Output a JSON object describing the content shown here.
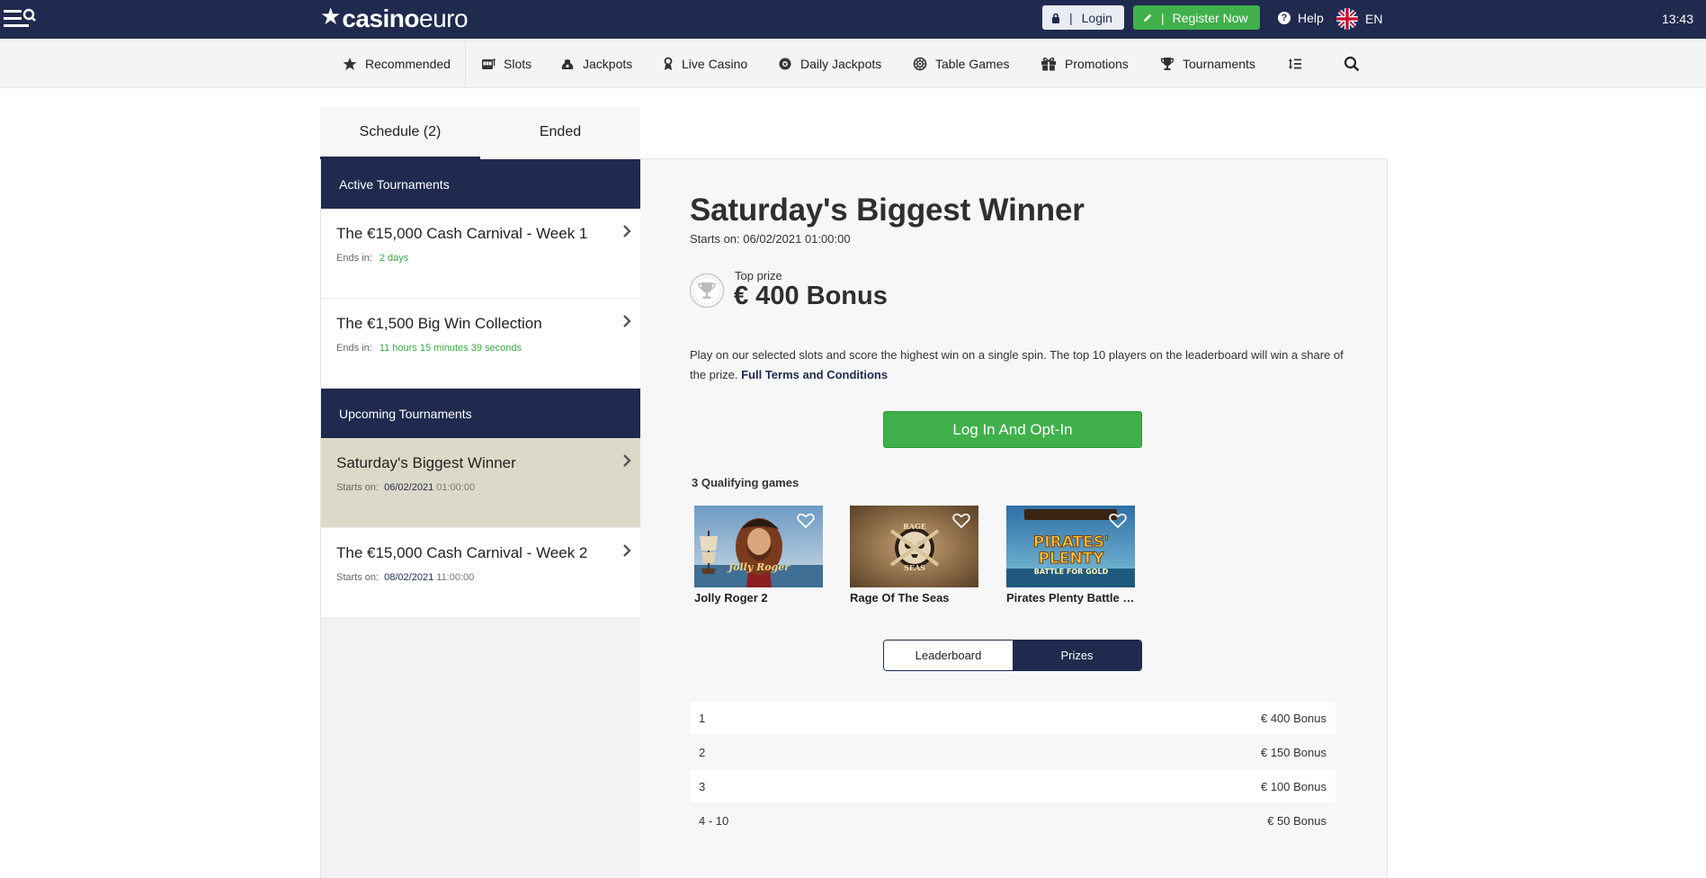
{
  "header": {
    "logo_part1": "casino",
    "logo_part2": "euro",
    "login_label": "Login",
    "register_label": "Register Now",
    "help_label": "Help",
    "language": "EN",
    "time": "13:43"
  },
  "nav": {
    "items": [
      {
        "label": "Recommended",
        "icon": "star-icon"
      },
      {
        "label": "Slots",
        "icon": "slot-machine-icon"
      },
      {
        "label": "Jackpots",
        "icon": "jackpot-icon"
      },
      {
        "label": "Live Casino",
        "icon": "live-casino-icon"
      },
      {
        "label": "Daily Jackpots",
        "icon": "daily-jackpot-icon"
      },
      {
        "label": "Table Games",
        "icon": "roulette-icon"
      },
      {
        "label": "Promotions",
        "icon": "gift-icon"
      },
      {
        "label": "Tournaments",
        "icon": "trophy-icon"
      }
    ]
  },
  "tabs": {
    "schedule": "Schedule (2)",
    "ended": "Ended"
  },
  "sidebar": {
    "active_heading": "Active Tournaments",
    "upcoming_heading": "Upcoming Tournaments",
    "active": [
      {
        "name": "The €15,000 Cash Carnival - Week 1",
        "meta_label": "Ends in:",
        "meta_value": "2 days"
      },
      {
        "name": "The €1,500 Big Win Collection",
        "meta_label": "Ends in:",
        "meta_value": "11 hours 15 minutes 39 seconds"
      }
    ],
    "upcoming": [
      {
        "name": "Saturday's Biggest Winner",
        "meta_label": "Starts on:",
        "date": "06/02/2021",
        "time": "01:00:00"
      },
      {
        "name": "The €15,000 Cash Carnival - Week 2",
        "meta_label": "Starts on:",
        "date": "08/02/2021",
        "time": "11:00:00"
      }
    ]
  },
  "detail": {
    "title": "Saturday's Biggest Winner",
    "starts_label": "Starts on:",
    "starts_value": "06/02/2021 01:00:00",
    "top_prize_label": "Top prize",
    "top_prize_value": "€ 400 Bonus",
    "description": "Play on our selected slots and score the highest win on a single spin. The top 10 players on the leaderboard will win a share of the prize.",
    "terms_link": "Full Terms and Conditions",
    "optin_button": "Log In And Opt-In",
    "qualifying_heading": "3 Qualifying games",
    "games": [
      {
        "name": "Jolly Roger 2"
      },
      {
        "name": "Rage Of The Seas"
      },
      {
        "name": "Pirates Plenty Battle for Gold"
      }
    ],
    "toggle": {
      "leaderboard": "Leaderboard",
      "prizes": "Prizes",
      "active": "prizes"
    },
    "prizes": [
      {
        "rank": "1",
        "prize": "€ 400 Bonus"
      },
      {
        "rank": "2",
        "prize": "€ 150 Bonus"
      },
      {
        "rank": "3",
        "prize": "€ 100 Bonus"
      },
      {
        "rank": "4 - 10",
        "prize": "€ 50 Bonus"
      }
    ]
  },
  "colors": {
    "navy": "#1f2a4e",
    "green": "#3fb04a",
    "selected_row": "#ddd9c8"
  }
}
